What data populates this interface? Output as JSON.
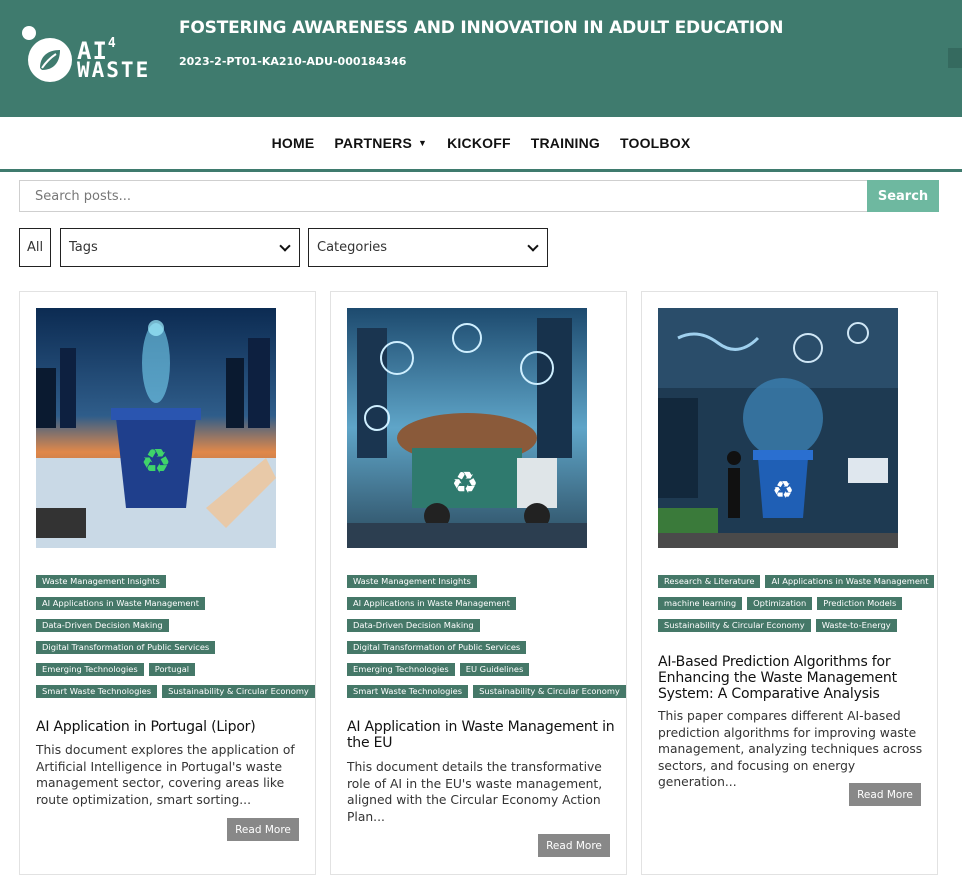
{
  "header": {
    "logo_line1": "AI",
    "logo_sup": "4",
    "logo_line2": "WASTE",
    "title": "FOSTERING AWARENESS AND INNOVATION IN ADULT EDUCATION",
    "code": "2023-2-PT01-KA210-ADU-000184346"
  },
  "nav": {
    "items": [
      {
        "label": "HOME"
      },
      {
        "label": "PARTNERS"
      },
      {
        "label": "KICKOFF"
      },
      {
        "label": "TRAINING"
      },
      {
        "label": "TOOLBOX"
      }
    ]
  },
  "search": {
    "placeholder": "Search posts...",
    "button_label": "Search"
  },
  "filters": {
    "all_label": "All",
    "tags_label": "Tags",
    "categories_label": "Categories"
  },
  "colors": {
    "brand": "#3f7b6e",
    "search_button": "#6eb8a0",
    "tag_bg": "#457868",
    "read_more_bg": "#888888"
  },
  "posts": [
    {
      "tag_rows": [
        [
          "Waste Management Insights"
        ],
        [
          "AI Applications in Waste Management"
        ],
        [
          "Data-Driven Decision Making"
        ],
        [
          "Digital Transformation of Public Services"
        ],
        [
          "Emerging Technologies",
          "Portugal"
        ],
        [
          "Smart Waste Technologies",
          "Sustainability & Circular Economy"
        ]
      ],
      "title": "AI Application in Portugal (Lipor)",
      "description": "This document explores the application of Artificial Intelligence in Portugal's waste management sector, covering areas like route optimization, smart sorting...",
      "read_more": "Read More"
    },
    {
      "tag_rows": [
        [
          "Waste Management Insights"
        ],
        [
          "AI Applications in Waste Management"
        ],
        [
          "Data-Driven Decision Making"
        ],
        [
          "Digital Transformation of Public Services"
        ],
        [
          "Emerging Technologies",
          "EU Guidelines"
        ],
        [
          "Smart Waste Technologies",
          "Sustainability & Circular Economy"
        ]
      ],
      "title": "AI Application in Waste Management in the EU",
      "description": "This document details the transformative role of AI in the EU's waste management, aligned with the Circular Economy Action Plan...",
      "read_more": "Read More"
    },
    {
      "tag_rows": [
        [
          "Research & Literature",
          "AI Applications in Waste Management"
        ],
        [
          "machine learning",
          "Optimization",
          "Prediction Models"
        ],
        [
          "Sustainability & Circular Economy",
          "Waste-to-Energy"
        ]
      ],
      "title": "AI-Based Prediction Algorithms for Enhancing the Waste Management System: A Comparative Analysis",
      "description": "This paper compares different AI-based prediction algorithms for improving waste management, analyzing techniques across sectors, and focusing on energy generation...",
      "read_more": "Read More"
    }
  ]
}
